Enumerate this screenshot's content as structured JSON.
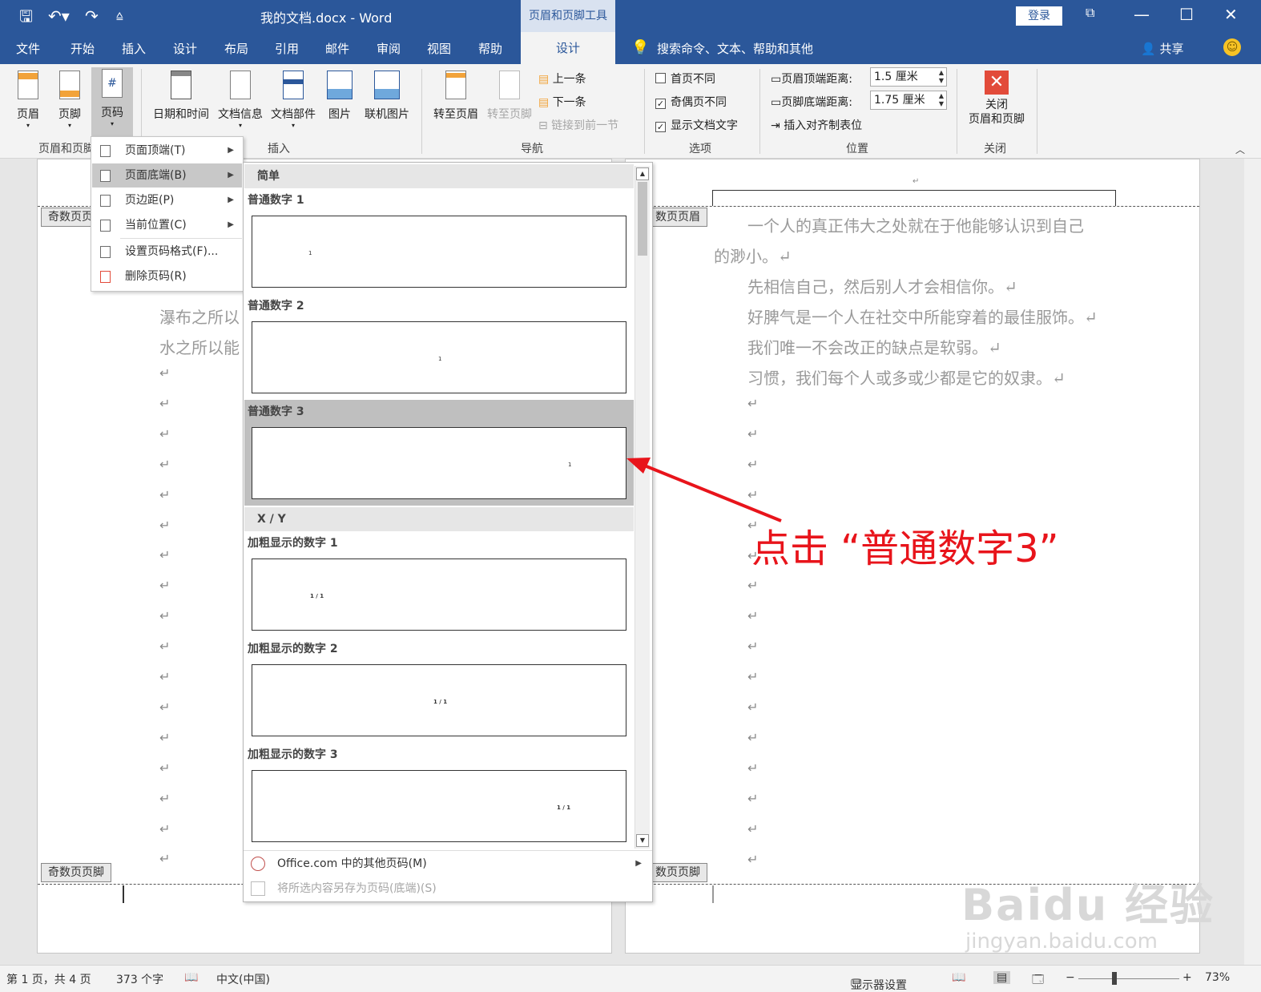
{
  "titlebar": {
    "doc_title": "我的文档.docx  -  Word",
    "tool_title": "页眉和页脚工具",
    "login": "登录"
  },
  "tabs": [
    "文件",
    "开始",
    "插入",
    "设计",
    "布局",
    "引用",
    "邮件",
    "审阅",
    "视图",
    "帮助"
  ],
  "active_tab": "设计",
  "search_placeholder": "搜索命令、文本、帮助和其他",
  "share": "共享",
  "ribbon": {
    "btn_header": "页眉",
    "btn_footer": "页脚",
    "btn_pagenum": "页码",
    "btn_datetime": "日期和时间",
    "btn_docinfo": "文档信息",
    "btn_docparts": "文档部件",
    "btn_picture": "图片",
    "btn_online_picture": "联机图片",
    "btn_goto_header": "转至页眉",
    "btn_goto_footer": "转至页脚",
    "btn_prev": "上一条",
    "btn_next": "下一条",
    "btn_link_prev": "链接到前一节",
    "opt_first_diff": "首页不同",
    "opt_oddeven_diff": "奇偶页不同",
    "opt_show_doc_text": "显示文档文字",
    "header_top_label": "页眉顶端距离:",
    "header_top_value": "1.5 厘米",
    "footer_bottom_label": "页脚底端距离:",
    "footer_bottom_value": "1.75 厘米",
    "insert_align_tab": "插入对齐制表位",
    "btn_close_line1": "关闭",
    "btn_close_line2": "页眉和页脚",
    "groups": {
      "hf": "页眉和页脚",
      "insert": "插入",
      "nav": "导航",
      "options": "选项",
      "position": "位置",
      "close": "关闭"
    }
  },
  "page_menu": {
    "items": [
      "页面顶端(T)",
      "页面底端(B)",
      "页边距(P)",
      "当前位置(C)",
      "设置页码格式(F)...",
      "删除页码(R)"
    ]
  },
  "gallery": {
    "section_simple": "简单",
    "section_xy": "X / Y",
    "items": [
      "普通数字 1",
      "普通数字 2",
      "普通数字 3",
      "加粗显示的数字 1",
      "加粗显示的数字 2",
      "加粗显示的数字 3"
    ],
    "sample_num": "1",
    "sample_xy": "1 / 1",
    "footer_more": "Office.com 中的其他页码(M)",
    "footer_save": "将所选内容另存为页码(底端)(S)"
  },
  "doc": {
    "left_header_tag": "奇数页页",
    "left_footer_tag": "奇数页页脚",
    "right_header_tag": "数页页眉",
    "right_footer_tag": "数页页脚",
    "left_lines": [
      "瀑布之所以",
      "水之所以能"
    ],
    "right_lines": [
      "一个人的真正伟大之处就在于他能够认识到自己",
      "的渺小。↵",
      "先相信自己，然后别人才会相信你。↵",
      "好脾气是一个人在社交中所能穿着的最佳服饰。↵",
      "我们唯一不会改正的缺点是软弱。↵",
      "习惯，我们每个人或多或少都是它的奴隶。↵"
    ],
    "para_mark": "↵"
  },
  "annotation": "点击 “普通数字3”",
  "watermark": "Baidu 经验",
  "watermark_url": "jingyan.baidu.com",
  "statusbar": {
    "page": "第 1 页，共 4 页",
    "words": "373 个字",
    "lang": "中文(中国)",
    "display": "显示器设置",
    "zoom": "73%"
  },
  "colors": {
    "accent": "#2b579a",
    "annotation": "#e8141b"
  }
}
